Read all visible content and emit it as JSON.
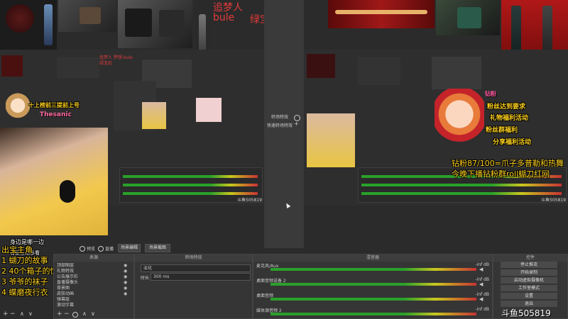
{
  "banner": {
    "line1_left": "追梦人",
    "line1_right": "梦想",
    "line2_left": "bule",
    "line2_right": "绿宝石"
  },
  "studio": {
    "left_mini_banner": "追梦人 梦想 bule 绿宝石",
    "transition_header": "转场特效",
    "transition_row": "快速转场特效",
    "room_id_left": "斗鱼505819",
    "room_id_right": "斗鱼505819"
  },
  "chat_overlay": {
    "line1": "十上榜前三提前上号",
    "line2": "Thesanic"
  },
  "right_overlay": {
    "line1": "钻粉87/100=爪子多普勒和热舞",
    "line2": "今晚下播钻粉群roll蝴刀红网",
    "top_tag": "钻粉",
    "side1": "粉丝达到要求",
    "side2": "礼物福利活动",
    "side3": "粉丝群福利",
    "side4": "分享福利活动"
  },
  "left_overlay": {
    "title": "身边是哪一边",
    "title2": "有爱互动多看",
    "heading": "出宝主角",
    "items": [
      "1 蝴刀的故事",
      "2 40个箱子的惊喜",
      "3 爷爷的袜子",
      "4 蝶磨夜行衣"
    ]
  },
  "controls_row": {
    "check1": "预览",
    "check2": "直播",
    "btn1": "场景编辑",
    "btn2": "场景截图"
  },
  "scenes_dock": {
    "header": "来源",
    "items": [
      "顶部图层",
      "礼物特效",
      "公告展示栏",
      "直播摄像头",
      "背景图",
      "皮肤动画",
      "弹幕层",
      "滚动字幕",
      "弹幕",
      "背景音"
    ],
    "footer_left": "场景",
    "footer_right": "来源"
  },
  "transition_dock": {
    "header": "转场特效",
    "field1_label": "淡化",
    "field2_label": "时长",
    "field2_value": "300 ms"
  },
  "mixer": {
    "header": "混音器",
    "channels": [
      {
        "name": "麦克风/Aux",
        "db": "-inf dB"
      },
      {
        "name": "桌面音频设备 2",
        "db": "-inf dB"
      },
      {
        "name": "桌面音频",
        "db": "-inf dB"
      },
      {
        "name": "媒体源音频 2",
        "db": "-inf dB"
      }
    ]
  },
  "control_dock": {
    "header": "控件",
    "buttons": [
      "停止推流",
      "开始录制",
      "启动虚拟摄像机",
      "工作室模式",
      "设置",
      "退出"
    ]
  },
  "watermark": "斗鱼505819",
  "colors": {
    "accent_red": "#e33a3a",
    "overlay_yellow": "#ffd21e",
    "meter_green": "#2aa02a"
  }
}
